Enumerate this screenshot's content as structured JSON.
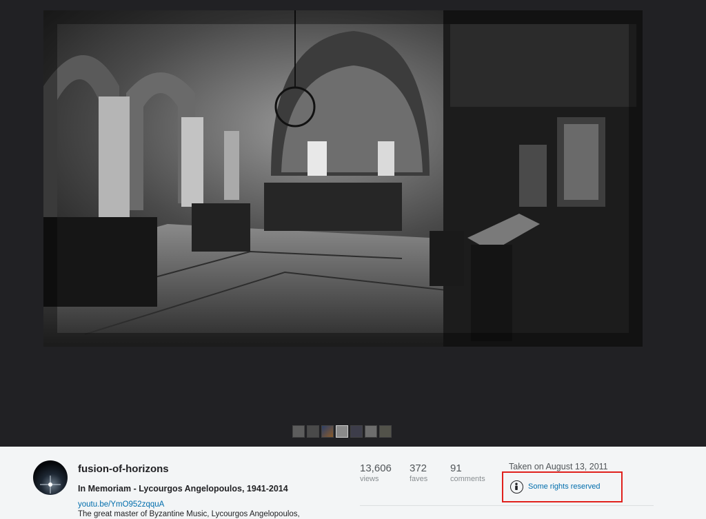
{
  "photo": {
    "alt_icon": "church-interior-photo"
  },
  "filmstrip": {
    "count": 7,
    "active_index": 3
  },
  "owner": {
    "name": "fusion-of-horizons"
  },
  "photo_info": {
    "title": "In Memoriam - Lycourgos Angelopoulos, 1941-2014",
    "link": "youtu.be/YmO952zqquA",
    "description": "The great master of Byzantine Music, Lycourgos Angelopoulos,"
  },
  "stats": {
    "views": {
      "value": "13,606",
      "label": "views"
    },
    "faves": {
      "value": "372",
      "label": "faves"
    },
    "comments": {
      "value": "91",
      "label": "comments"
    }
  },
  "taken": "Taken on August 13, 2011",
  "license": {
    "text": "Some rights reserved",
    "icon": "attribution-icon"
  },
  "colors": {
    "stage": "#212124",
    "panel": "#f3f5f6",
    "link": "#006dac",
    "highlight": "#e0201c"
  }
}
